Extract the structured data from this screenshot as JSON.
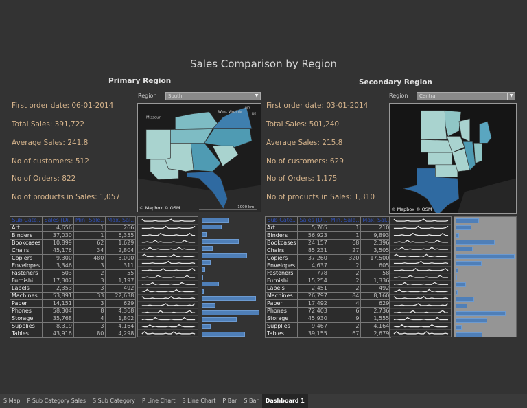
{
  "title": "Sales Comparison by Region",
  "colors": {
    "stat_text": "#d6b48c",
    "bar": "#4f7fb8",
    "header_text": "#2f4fb5"
  },
  "table_headers": [
    "Sub Cate..",
    "Sales (Di..",
    "Min. Sale..",
    "Max. Sal.."
  ],
  "primary": {
    "heading": "Primary Region",
    "region_label": "Region",
    "region_value": "South",
    "stats": [
      "First order date: 06-01-2014",
      "Total Sales: 391,722",
      "Average Sales: 241.8",
      "No of customers: 512",
      "No of Orders: 822",
      "No of products in Sales: 1,057"
    ],
    "map": {
      "attribution": "© Mapbox © OSM",
      "scale": "1000 km",
      "labels": [
        "Missouri",
        "West Virginia",
        "MD",
        "DE"
      ]
    },
    "rows": [
      [
        "Art",
        "4,656",
        "1",
        "266"
      ],
      [
        "Binders",
        "37,030",
        "1",
        "6,355"
      ],
      [
        "Bookcases",
        "10,899",
        "62",
        "1,629"
      ],
      [
        "Chairs",
        "45,176",
        "34",
        "2,804"
      ],
      [
        "Copiers",
        "9,300",
        "480",
        "3,000"
      ],
      [
        "Envelopes",
        "3,346",
        "3",
        "311"
      ],
      [
        "Fasteners",
        "503",
        "2",
        "55"
      ],
      [
        "Furnishi..",
        "17,307",
        "3",
        "1,197"
      ],
      [
        "Labels",
        "2,353",
        "3",
        "492"
      ],
      [
        "Machines",
        "53,891",
        "33",
        "22,638"
      ],
      [
        "Paper",
        "14,151",
        "3",
        "629"
      ],
      [
        "Phones",
        "58,304",
        "8",
        "4,368"
      ],
      [
        "Storage",
        "35,768",
        "4",
        "1,802"
      ],
      [
        "Supplies",
        "8,319",
        "3",
        "4,164"
      ],
      [
        "Tables",
        "43,916",
        "80",
        "4,298"
      ]
    ],
    "bar_fractions": [
      0.47,
      0.34,
      0.08,
      0.64,
      0.19,
      0.78,
      0.16,
      0.06,
      0.01,
      0.3,
      0.04,
      0.94,
      0.24,
      1.0,
      0.61,
      0.15,
      0.75
    ]
  },
  "secondary": {
    "heading": "Secondary Region",
    "region_label": "Region",
    "region_value": "Central",
    "stats": [
      "First order date: 03-01-2014",
      "Total Sales: 501,240",
      "Average Sales: 215.8",
      "No of customers: 629",
      "No of Orders: 1,175",
      "No of products in Sales: 1,310"
    ],
    "map": {
      "attribution": "© Mapbox © OSM"
    },
    "rows": [
      [
        "Art",
        "5,765",
        "1",
        "210"
      ],
      [
        "Binders",
        "56,923",
        "1",
        "9,893"
      ],
      [
        "Bookcases",
        "24,157",
        "68",
        "2,396"
      ],
      [
        "Chairs",
        "85,231",
        "27",
        "3,505"
      ],
      [
        "Copiers",
        "37,260",
        "320",
        "17,500"
      ],
      [
        "Envelopes",
        "4,637",
        "2",
        "605"
      ],
      [
        "Fasteners",
        "778",
        "2",
        "58"
      ],
      [
        "Furnishi..",
        "15,254",
        "2",
        "1,336"
      ],
      [
        "Labels",
        "2,451",
        "2",
        "492"
      ],
      [
        "Machines",
        "26,797",
        "84",
        "8,160"
      ],
      [
        "Paper",
        "17,492",
        "4",
        "629"
      ],
      [
        "Phones",
        "72,403",
        "6",
        "2,736"
      ],
      [
        "Storage",
        "45,930",
        "9",
        "1,555"
      ],
      [
        "Supplies",
        "9,467",
        "2",
        "4,164"
      ],
      [
        "Tables",
        "39,155",
        "67",
        "2,679"
      ]
    ],
    "bar_fractions": [
      0.39,
      0.27,
      0.06,
      0.66,
      0.29,
      1.0,
      0.44,
      0.05,
      0.01,
      0.17,
      0.03,
      0.31,
      0.2,
      0.85,
      0.54,
      0.1,
      0.45
    ]
  },
  "tabs": [
    {
      "label": "S Map"
    },
    {
      "label": "P Sub Category Sales"
    },
    {
      "label": "S Sub Category"
    },
    {
      "label": "P Line Chart"
    },
    {
      "label": "S Line Chart"
    },
    {
      "label": "P Bar"
    },
    {
      "label": "S Bar"
    },
    {
      "label": "Dashboard 1",
      "active": true
    }
  ]
}
